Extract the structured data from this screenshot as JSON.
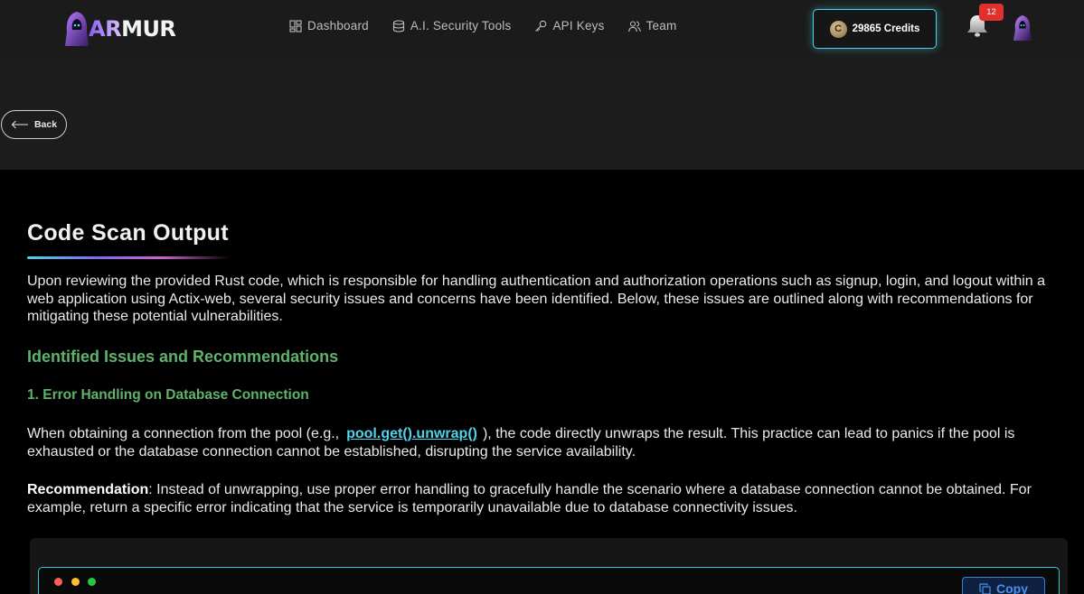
{
  "header": {
    "logo_text_accent": "AR",
    "logo_text_main": "MUR",
    "nav": [
      {
        "label": "Dashboard",
        "icon": "dashboard-icon"
      },
      {
        "label": "A.I. Security Tools",
        "icon": "database-icon"
      },
      {
        "label": "API Keys",
        "icon": "key-icon"
      },
      {
        "label": "Team",
        "icon": "team-icon"
      }
    ],
    "credits_label": "29865 Credits",
    "coin_symbol": "C",
    "notification_count": "12"
  },
  "backbar": {
    "back_label": "Back"
  },
  "main": {
    "title": "Code Scan Output",
    "intro": "Upon reviewing the provided Rust code, which is responsible for handling authentication and authorization operations such as signup, login, and logout within a web application using Actix-web, several security issues and concerns have been identified. Below, these issues are outlined along with recommendations for mitigating these potential vulnerabilities.",
    "section_heading": "Identified Issues and Recommendations",
    "issue_heading": "1. Error Handling on Database Connection",
    "issue_text_before": "When obtaining a connection from the pool (e.g.,",
    "issue_code": "pool.get().unwrap()",
    "issue_text_after": "), the code directly unwraps the result. This practice can lead to panics if the pool is exhausted or the database connection cannot be established, disrupting the service availability.",
    "recommendation_label": "Recommendation",
    "recommendation_text": ": Instead of unwrapping, use proper error handling to gracefully handle the scenario where a database connection cannot be obtained. For example, return a specific error indicating that the service is temporarily unavailable due to database connectivity issues.",
    "copy_label": "Copy"
  },
  "colors": {
    "accent_cyan": "#46d4e6",
    "heading_green": "#5fb36b",
    "badge_red": "#e0312f",
    "copy_blue": "#4a90f0"
  }
}
